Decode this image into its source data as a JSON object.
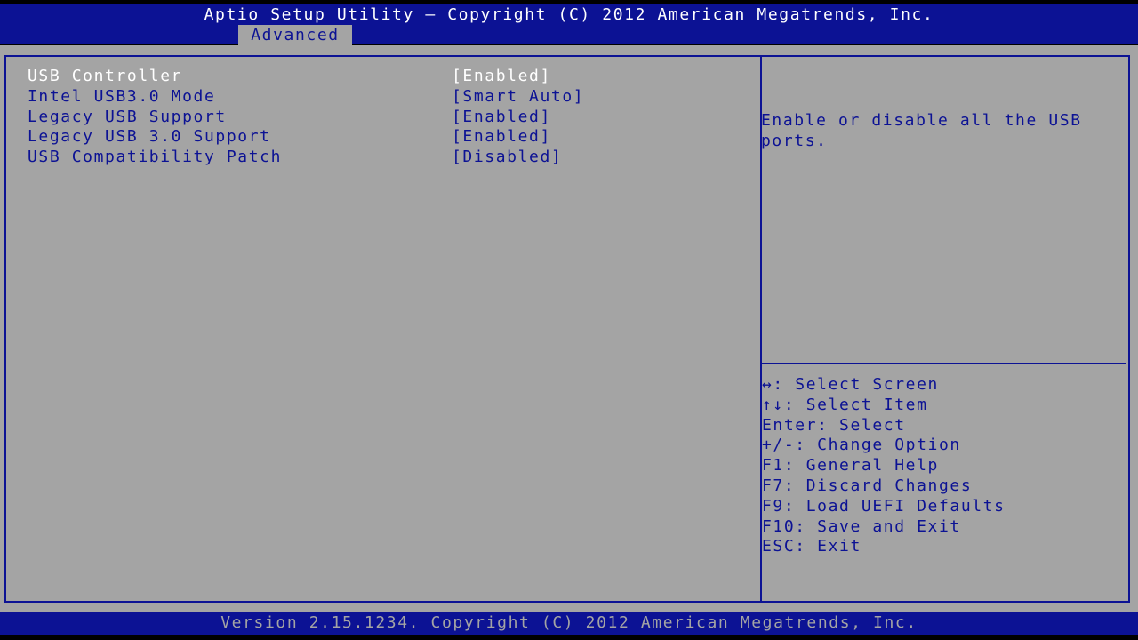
{
  "header": {
    "title": "Aptio Setup Utility – Copyright (C) 2012 American Megatrends, Inc.",
    "active_tab": "Advanced"
  },
  "settings": [
    {
      "label": "USB Controller",
      "value": "[Enabled]",
      "selected": true
    },
    {
      "label": "Intel USB3.0 Mode",
      "value": "[Smart Auto]",
      "selected": false
    },
    {
      "label": "Legacy USB Support",
      "value": "[Enabled]",
      "selected": false
    },
    {
      "label": "Legacy USB 3.0 Support",
      "value": "[Enabled]",
      "selected": false
    },
    {
      "label": "USB Compatibility Patch",
      "value": "[Disabled]",
      "selected": false
    }
  ],
  "help": {
    "text": "Enable or disable all the USB ports.",
    "keys": [
      "↔: Select Screen",
      "↑↓: Select Item",
      "Enter: Select",
      "+/-: Change Option",
      "F1: General Help",
      "F7: Discard Changes",
      "F9: Load UEFI Defaults",
      "F10: Save and Exit",
      "ESC: Exit"
    ]
  },
  "footer": {
    "text": "Version 2.15.1234. Copyright (C) 2012 American Megatrends, Inc."
  },
  "colors": {
    "bar_blue": "#0c1294",
    "panel_gray": "#a4a4a4",
    "highlight": "#ffffff"
  }
}
